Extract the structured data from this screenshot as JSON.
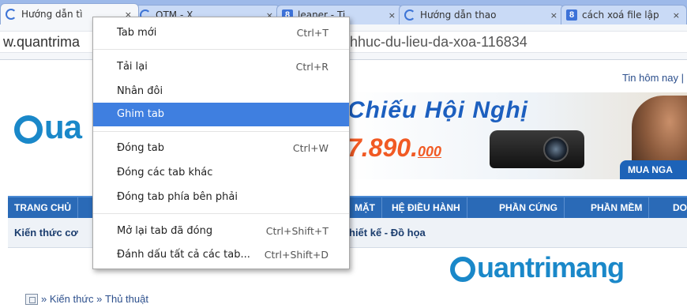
{
  "tabs": [
    {
      "title": "Hướng dẫn tì",
      "favicon": "loading-icon",
      "close": "×",
      "active": true
    },
    {
      "title": "QTM - X",
      "favicon": "loading-icon",
      "close": "×",
      "active": false
    },
    {
      "title": "leaner - Ti",
      "favicon": "google-icon",
      "favicon_letter": "8",
      "close": "×",
      "active": false
    },
    {
      "title": "Hướng dẫn thao",
      "favicon": "loading-icon",
      "close": "×",
      "active": false
    },
    {
      "title": "cách xoá file lập",
      "favicon": "google-icon",
      "favicon_letter": "8",
      "close": "×",
      "active": false
    }
  ],
  "omnibox": {
    "url_start": "w.quantrima",
    "url_end": "hhuc-du-lieu-da-xoa-116834"
  },
  "page": {
    "topright": "Tin hôm nay |",
    "logo_left": "ua",
    "banner": {
      "title": "Chiếu Hội Nghị",
      "price": "7.890.",
      "currency": "000",
      "button": "MUA NGA"
    },
    "nav": [
      "TRANG CHỦ",
      "MẶT",
      "HỆ ĐIỀU HÀNH",
      "PHẦN CỨNG",
      "PHẦN MỀM",
      "DO"
    ],
    "subnav": [
      "Kiến thức cơ",
      "hiết kế - Đồ họa"
    ],
    "logo_mid": "uantrimang",
    "breadcrumb": [
      "»",
      "Kiến thức",
      "»",
      "Thủ thuật"
    ]
  },
  "context_menu": {
    "items": [
      {
        "label": "Tab mới",
        "shortcut": "Ctrl+T"
      },
      {
        "label": "Tải lại",
        "shortcut": "Ctrl+R"
      },
      {
        "label": "Nhân đôi",
        "shortcut": ""
      },
      {
        "label": "Ghim tab",
        "shortcut": "",
        "highlighted": true
      },
      {
        "label": "Đóng tab",
        "shortcut": "Ctrl+W"
      },
      {
        "label": "Đóng các tab khác",
        "shortcut": ""
      },
      {
        "label": "Đóng tab phía bên phải",
        "shortcut": ""
      },
      {
        "label": "Mở lại tab đã đóng",
        "shortcut": "Ctrl+Shift+T"
      },
      {
        "label": "Đánh dấu tất cả các tab...",
        "shortcut": "Ctrl+Shift+D"
      }
    ]
  },
  "colors": {
    "menu_highlight": "#3f7fe0",
    "nav_bg": "#2a6ab7",
    "logo_blue": "#1a88c9",
    "price_orange": "#f15a24"
  }
}
